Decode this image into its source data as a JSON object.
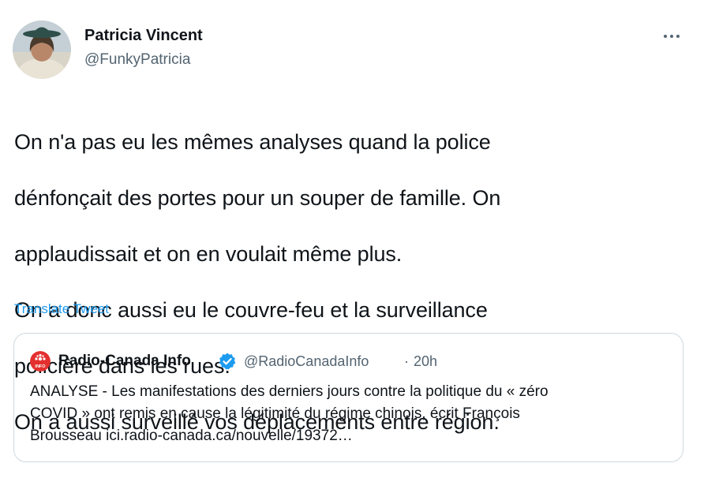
{
  "tweet": {
    "author_name": "Patricia Vincent",
    "author_handle": "@FunkyPatricia",
    "more_label": "More",
    "text_lines": [
      "On n'a pas eu les mêmes analyses quand la police",
      "dénfonçait des portes pour un souper de famille. On",
      "applaudissait et on en voulait même plus.",
      "On a donc aussi eu le couvre-feu et la surveillance",
      "policière dans les rues.",
      "On a aussi surveillé vos déplacements entre région."
    ],
    "translate_label": "Translate Tweet"
  },
  "quote": {
    "name": "Radio-Canada Info",
    "handle": "@RadioCanadaInfo",
    "separator": "·",
    "time": "20h",
    "logo_label": "INFO",
    "text_lines": [
      "ANALYSE - Les manifestations des derniers jours contre la politique du « zéro",
      "COVID » ont remis en cause la légitimité du régime chinois, écrit François",
      "Brousseau ici.radio-canada.ca/nouvelle/19372…"
    ]
  },
  "colors": {
    "text": "#0f1419",
    "secondary": "#536471",
    "link": "#1d9bf0",
    "border": "#cfd9de",
    "radio_canada_red": "#e3302f",
    "verified": "#1d9bf0"
  },
  "icons": [
    "avatar",
    "more-dots-icon",
    "radio-canada-logo-icon",
    "verified-badge-icon"
  ]
}
